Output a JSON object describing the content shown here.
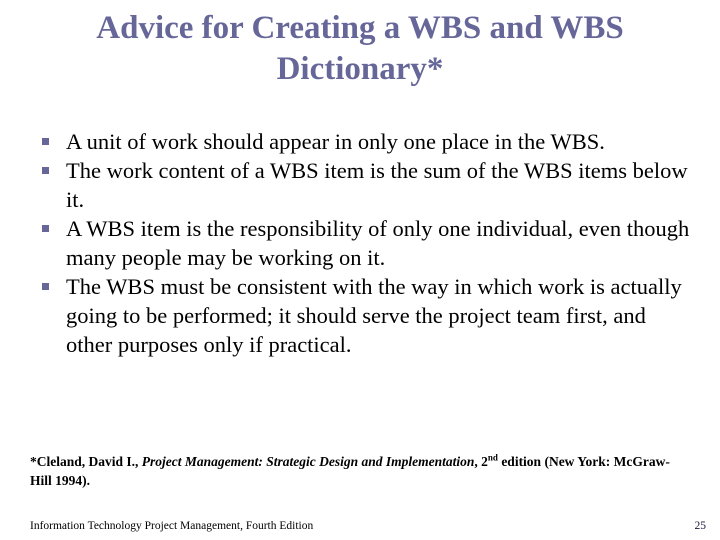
{
  "slide": {
    "background_color": "#ffffff",
    "accent_color": "#666699",
    "text_color": "#000000",
    "title": "Advice for Creating a WBS and WBS Dictionary*",
    "bullets": [
      {
        "marker": "square-bullet-icon",
        "text": "A unit of work should appear in only one place in the WBS."
      },
      {
        "marker": "square-bullet-icon",
        "text": "The work content of a WBS item is the sum of the WBS items below it."
      },
      {
        "marker": "square-bullet-icon",
        "text": "A WBS item is the responsibility of only one individual, even though many people may be working on it."
      },
      {
        "marker": "square-bullet-icon",
        "text": "The WBS must be consistent with the way in which work is actually going to be performed; it should serve the project team first, and other purposes only if practical."
      }
    ],
    "footnote": {
      "prefix": "*Cleland, David I., ",
      "title_italic": "Project Management: Strategic Design and Implementation",
      "after_italic": ", 2",
      "superscript": "nd",
      "suffix": " edition (New York: McGraw-Hill 1994)."
    },
    "footer": {
      "book_title": "Information Technology Project Management, Fourth Edition",
      "page_number": "25"
    }
  }
}
